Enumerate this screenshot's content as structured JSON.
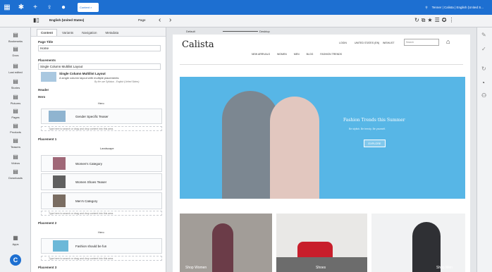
{
  "topbar": {
    "tab_label": "Content",
    "user": "Tenner | Calista | English (United S..."
  },
  "secbar": {
    "language": "English (United States)",
    "page": "Page"
  },
  "leftnav": [
    {
      "label": "Bookmarks"
    },
    {
      "label": "Docs"
    },
    {
      "label": "Last edited"
    },
    {
      "label": "Stories"
    },
    {
      "label": "Pictures"
    },
    {
      "label": "Pages"
    },
    {
      "label": "Products"
    },
    {
      "label": "Teasers"
    },
    {
      "label": "Videos"
    },
    {
      "label": "Downloads"
    },
    {
      "label": "Apps"
    }
  ],
  "panel": {
    "tabs": [
      "Content",
      "Variants",
      "Navigation",
      "Metadata"
    ],
    "page_title_label": "Page Title",
    "page_title_value": "Home",
    "placements_label": "Placements",
    "layout_select": "Single Column Multilist Layout",
    "layout_name": "Single Column Multilist Layout",
    "layout_desc": "A single column layout with multiple placements",
    "layout_note": "By the use Syllabus - English (United States)",
    "header_label": "Header",
    "hero_label": "Hero",
    "hero_dropdown": "Hero",
    "hero_item": "Gender Specific Teaser",
    "add_hint": "Type here to search or drag and drop content into this area.",
    "placement1_label": "Placement 1",
    "placement1_dropdown": "Landscape",
    "p1_items": [
      "Women's Category",
      "Women Shoes Teaser",
      "Men's Category"
    ],
    "placement2_label": "Placement 2",
    "placement2_dropdown": "Hero",
    "p2_items": [
      "Fashion should be fun"
    ],
    "placement3_label": "Placement 3"
  },
  "canvas": {
    "default_label": "Default",
    "device_label": "Desktop"
  },
  "site": {
    "logo": "Calista",
    "top_links": [
      "LOGIN",
      "UNITED STATES (EN)",
      "WISHLIST"
    ],
    "search_placeholder": "Search",
    "nav": [
      "NEW ARRIVALS",
      "WOMEN",
      "MEN",
      "BLOG",
      "FASHION TRENDS"
    ],
    "hero_title": "Fashion Trends this Summer",
    "hero_subtitle": "Be stylish. Be trendy. Be yourself.",
    "hero_button": "EXPLORE",
    "cards": [
      "Shop Women",
      "Shoes",
      "Shop Men"
    ]
  },
  "colors": {
    "brand_blue": "#1d6fd1",
    "hero_blue": "#57b6e6"
  }
}
